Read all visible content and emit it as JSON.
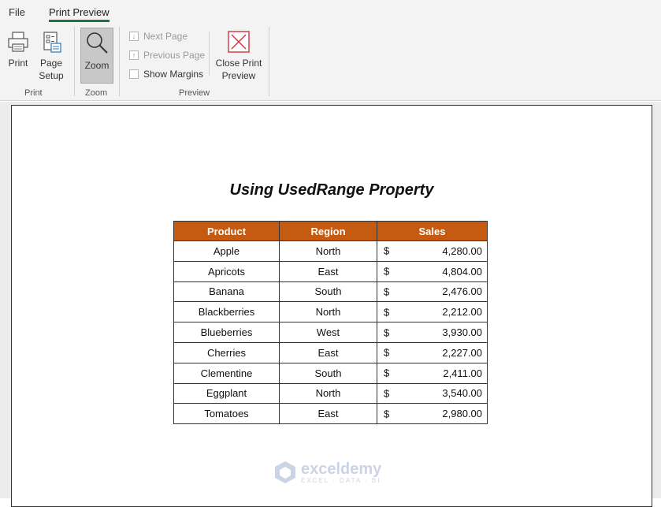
{
  "ribbon": {
    "tabs": {
      "file": "File",
      "print_preview": "Print Preview"
    },
    "print_group": {
      "print_label": "Print",
      "page_setup_line1": "Page",
      "page_setup_line2": "Setup",
      "group_label": "Print"
    },
    "zoom_group": {
      "zoom_label": "Zoom",
      "group_label": "Zoom"
    },
    "preview_group": {
      "next_page": "Next Page",
      "previous_page": "Previous Page",
      "show_margins": "Show Margins",
      "close_line1": "Close Print",
      "close_line2": "Preview",
      "group_label": "Preview"
    }
  },
  "document": {
    "title": "Using UsedRange Property",
    "headers": [
      "Product",
      "Region",
      "Sales"
    ],
    "currency": "$",
    "rows": [
      [
        "Apple",
        "North",
        "4,280.00"
      ],
      [
        "Apricots",
        "East",
        "4,804.00"
      ],
      [
        "Banana",
        "South",
        "2,476.00"
      ],
      [
        "Blackberries",
        "North",
        "2,212.00"
      ],
      [
        "Blueberries",
        "West",
        "3,930.00"
      ],
      [
        "Cherries",
        "East",
        "2,227.00"
      ],
      [
        "Clementine",
        "South",
        "2,411.00"
      ],
      [
        "Eggplant",
        "North",
        "3,540.00"
      ],
      [
        "Tomatoes",
        "East",
        "2,980.00"
      ]
    ],
    "header_color": "#c55a11"
  },
  "watermark": {
    "name": "exceldemy",
    "tagline": "EXCEL · DATA · BI"
  },
  "colors": {
    "accent": "#217346",
    "zoom_active": "#c8c8c8"
  }
}
